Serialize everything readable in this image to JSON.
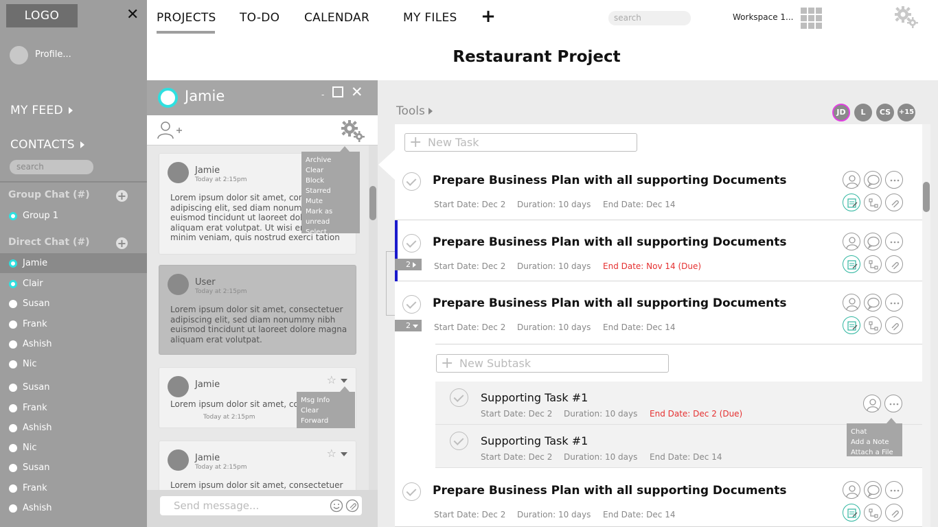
{
  "sidebar": {
    "logo": "LOGO",
    "profile": "Profile...",
    "my_feed": "MY FEED",
    "contacts": "CONTACTS",
    "search_placeholder": "search",
    "group_chat_header": "Group Chat (#)",
    "groups": [
      "Group 1"
    ],
    "direct_chat_header": "Direct Chat (#)",
    "direct_contacts": [
      {
        "name": "Jamie",
        "online": true,
        "active": true
      },
      {
        "name": "Clair",
        "online": true,
        "active": false
      },
      {
        "name": "Susan",
        "online": false,
        "active": false
      },
      {
        "name": "Frank",
        "online": false,
        "active": false
      },
      {
        "name": "Ashish",
        "online": false,
        "active": false
      },
      {
        "name": "Nic",
        "online": false,
        "active": false
      },
      {
        "name": "Susan",
        "online": false,
        "active": false
      },
      {
        "name": "Frank",
        "online": false,
        "active": false
      },
      {
        "name": "Ashish",
        "online": false,
        "active": false
      },
      {
        "name": "Nic",
        "online": false,
        "active": false
      },
      {
        "name": "Susan",
        "online": false,
        "active": false
      },
      {
        "name": "Frank",
        "online": false,
        "active": false
      },
      {
        "name": "Ashish",
        "online": false,
        "active": false
      }
    ]
  },
  "topnav": {
    "tabs": [
      "PROJECTS",
      "TO-DO",
      "CALENDAR",
      "MY FILES"
    ],
    "active_tab": "PROJECTS",
    "search_placeholder": "search",
    "workspace": "Workspace 1..."
  },
  "page_title": "Restaurant Project",
  "chat": {
    "contact_name": "Jamie",
    "minimize": "-",
    "settings_menu": [
      "Archive",
      "Clear",
      "Block",
      "Starred",
      "Mute",
      "Mark as unread",
      "Select"
    ],
    "message_menu": [
      "Msg Info",
      "Clear",
      "Forward"
    ],
    "messages": [
      {
        "sender": "Jamie",
        "time": "Today at 2:15pm",
        "text": "Lorem ipsum dolor sit amet, consectetuer adipiscing elit, sed diam nonummy nibh euismod tincidunt ut laoreet dolore magna aliquam erat volutpat. Ut wisi enim ad minim veniam, quis nostrud exerci tation",
        "mine": false
      },
      {
        "sender": "User",
        "time": "Today at 2:15pm",
        "text": "Lorem ipsum dolor sit amet, consectetuer adipiscing elit, sed diam nonummy nibh euismod tincidunt ut laoreet dolore magna aliquam erat volutpat.",
        "mine": true
      },
      {
        "sender": "Jamie",
        "time": "Today at 2:15pm",
        "text": "Lorem ipsum dolor sit amet, consectetuer",
        "mine": false
      },
      {
        "sender": "Jamie",
        "time": "Today at 2:15pm",
        "text": "Lorem ipsum dolor sit amet, consectetuer",
        "mine": false
      }
    ],
    "input_placeholder": "Send message..."
  },
  "tools": {
    "label": "Tools",
    "members": [
      "JD",
      "L",
      "CS",
      "+15"
    ],
    "new_task_placeholder": "New Task",
    "new_subtask_placeholder": "New Subtask"
  },
  "tasks": [
    {
      "title": "Prepare Business Plan with all supporting Documents",
      "start": "Start Date: Dec 2",
      "duration": "Duration: 10 days",
      "end": "End Date: Dec 14",
      "overdue": false,
      "counter": ""
    },
    {
      "title": "Prepare Business Plan with all supporting Documents",
      "start": "Start Date: Dec 2",
      "duration": "Duration: 10 days",
      "end": "End Date: Nov 14 (Due)",
      "overdue": true,
      "counter": "2"
    },
    {
      "title": "Prepare Business Plan with all supporting Documents",
      "start": "Start Date: Dec 2",
      "duration": "Duration: 10 days",
      "end": "End Date: Dec 14",
      "overdue": false,
      "counter": "2"
    },
    {
      "title": "Prepare Business Plan with all supporting Documents",
      "start": "Start Date: Dec 2",
      "duration": "Duration: 10 days",
      "end": "End Date: Dec 14",
      "overdue": false,
      "counter": ""
    }
  ],
  "subtasks": [
    {
      "title": "Supporting Task #1",
      "start": "Start Date: Dec 2",
      "duration": "Duration: 10 days",
      "end": "End Date: Dec 2 (Due)",
      "overdue": true
    },
    {
      "title": "Supporting Task #1",
      "start": "Start Date: Dec 2",
      "duration": "Duration: 10 days",
      "end": "End Date: Dec 14",
      "overdue": false
    }
  ],
  "task_menu": [
    "Chat",
    "Add a Note",
    "Attach a File"
  ],
  "colors": {
    "sidebar": "#9e9e9e",
    "online": "#2ee0e0",
    "due": "#e53030",
    "accent_bar": "#1a1acc",
    "member_highlight": "#e040e0",
    "teal_icon": "#2fb6a0"
  }
}
